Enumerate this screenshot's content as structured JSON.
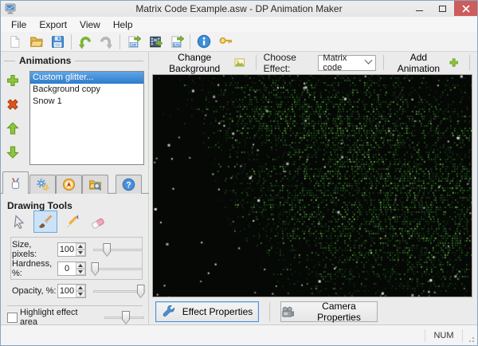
{
  "window": {
    "title": "Matrix Code Example.asw - DP Animation Maker"
  },
  "menu": {
    "items": [
      "File",
      "Export",
      "View",
      "Help"
    ]
  },
  "toolbar": {
    "icons": [
      "new-file-icon",
      "open-file-icon",
      "save-icon",
      "undo-icon",
      "redo-icon",
      "export-gif-icon",
      "export-video-icon",
      "export-exe-icon",
      "info-icon",
      "key-icon"
    ],
    "gif_badge": "GIF",
    "exe_badge": "EXE"
  },
  "animations": {
    "title": "Animations",
    "items": [
      {
        "label": "Custom glitter...",
        "selected": true
      },
      {
        "label": "Background copy",
        "selected": false
      },
      {
        "label": "Snow 1",
        "selected": false
      }
    ],
    "side_buttons": [
      "add-animation",
      "delete-animation",
      "move-up",
      "move-down"
    ]
  },
  "tabs": {
    "icons": [
      "drawing-tools-tab",
      "settings-tab",
      "navigation-tab",
      "browse-tab",
      "help-tab"
    ],
    "help_glyph": "?"
  },
  "drawing_tools": {
    "heading": "Drawing Tools",
    "tools": [
      "select-tool",
      "brush-tool",
      "pencil-tool",
      "eraser-tool"
    ],
    "selected_tool": "brush-tool",
    "size_label": "Size, pixels:",
    "size_value": "100",
    "size_thumb_percent": 28,
    "hardness_label": "Hardness, %:",
    "hardness_value": "0",
    "hardness_thumb_percent": 4,
    "opacity_label": "Opacity, %:",
    "opacity_value": "100",
    "opacity_thumb_percent": 96,
    "highlight_label": "Highlight effect area",
    "highlight_checked": false,
    "highlight_thumb_percent": 54
  },
  "effect_bar": {
    "change_background_label": "Change Background",
    "choose_effect_label": "Choose Effect:",
    "selected_effect": "Matrix code",
    "add_animation_label": "Add Animation"
  },
  "bottom_bar": {
    "effect_properties_label": "Effect Properties",
    "camera_properties_label": "Camera Properties"
  },
  "status_bar": {
    "num_label": "NUM"
  },
  "colors": {
    "accent_green": "#8cc63e",
    "delete_red": "#e0561e",
    "selection_blue": "#2e7ccb",
    "close_red": "#cd5c5c"
  },
  "canvas": {
    "background": "#050805",
    "green_palette": [
      "#11300f",
      "#1c4a19",
      "#2c6b24",
      "#418e33",
      "#61b147",
      "#8fd45f"
    ],
    "snow_color": "#f0f0ee"
  }
}
